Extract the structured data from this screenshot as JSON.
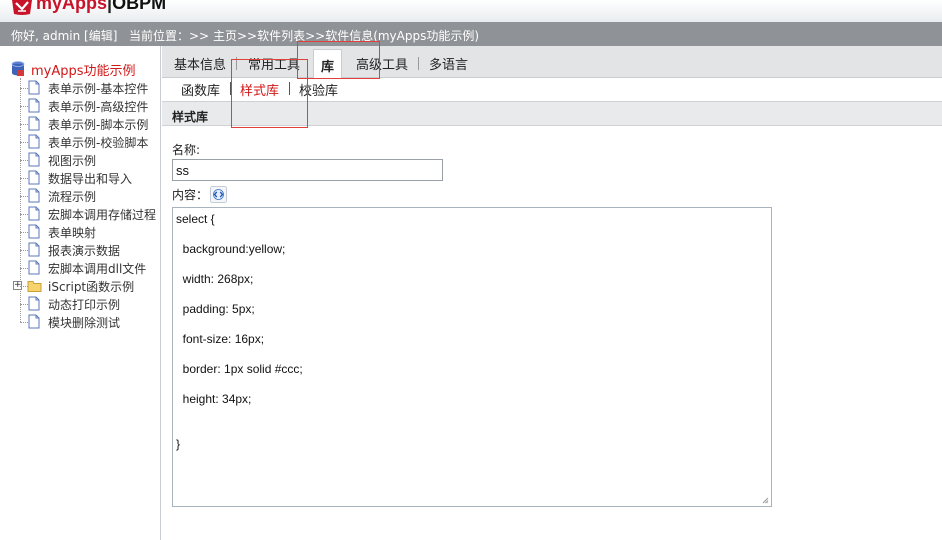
{
  "header": {
    "app_name": "myApps",
    "separator": "|",
    "suite": "OBPM"
  },
  "statusbar": {
    "greeting": "你好, admin [编辑]",
    "breadcrumb_prefix": "当前位置：>> ",
    "crumbs": [
      "主页",
      "软件列表",
      "软件信息(myApps功能示例)"
    ],
    "crumb_sep": ">>"
  },
  "tree": {
    "root_label": "myApps功能示例",
    "items": [
      {
        "label": "表单示例-基本控件",
        "type": "doc"
      },
      {
        "label": "表单示例-高级控件",
        "type": "doc"
      },
      {
        "label": "表单示例-脚本示例",
        "type": "doc"
      },
      {
        "label": "表单示例-校验脚本",
        "type": "doc"
      },
      {
        "label": "视图示例",
        "type": "doc"
      },
      {
        "label": "数据导出和导入",
        "type": "doc"
      },
      {
        "label": "流程示例",
        "type": "doc"
      },
      {
        "label": "宏脚本调用存储过程",
        "type": "doc"
      },
      {
        "label": "表单映射",
        "type": "doc"
      },
      {
        "label": "报表演示数据",
        "type": "doc"
      },
      {
        "label": "宏脚本调用dll文件",
        "type": "doc"
      },
      {
        "label": "iScript函数示例",
        "type": "folder"
      },
      {
        "label": "动态打印示例",
        "type": "doc"
      },
      {
        "label": "模块删除测试",
        "type": "doc"
      }
    ]
  },
  "tabs": [
    {
      "label": "基本信息",
      "active": false
    },
    {
      "label": "常用工具",
      "active": false
    },
    {
      "label": "库",
      "active": true
    },
    {
      "label": "高级工具",
      "active": false
    },
    {
      "label": "多语言",
      "active": false
    }
  ],
  "subtabs": [
    {
      "label": "函数库",
      "active": false
    },
    {
      "label": "样式库",
      "active": true
    },
    {
      "label": "校验库",
      "active": false
    }
  ],
  "subtab_sep": "|",
  "section": {
    "title": "样式库"
  },
  "form": {
    "name_label": "名称:",
    "name_value": "ss",
    "content_label": "内容：",
    "code_lines": [
      "select {",
      "",
      "  background:yellow;",
      "",
      "  width: 268px;",
      "",
      "  padding: 5px;",
      "",
      "  font-size: 16px;",
      "",
      "  border: 1px solid #ccc;",
      "",
      "  height: 34px;",
      "",
      "",
      "}"
    ]
  },
  "colors": {
    "brand_red": "#c8142a",
    "status_bar": "#8f9296",
    "active_link": "#d01818",
    "annotation": "#e0403a"
  },
  "icons": {
    "logo": "myapps-logo-icon",
    "tree_root": "database-icon",
    "doc": "document-icon",
    "folder": "folder-icon",
    "code": "code-format-icon"
  }
}
